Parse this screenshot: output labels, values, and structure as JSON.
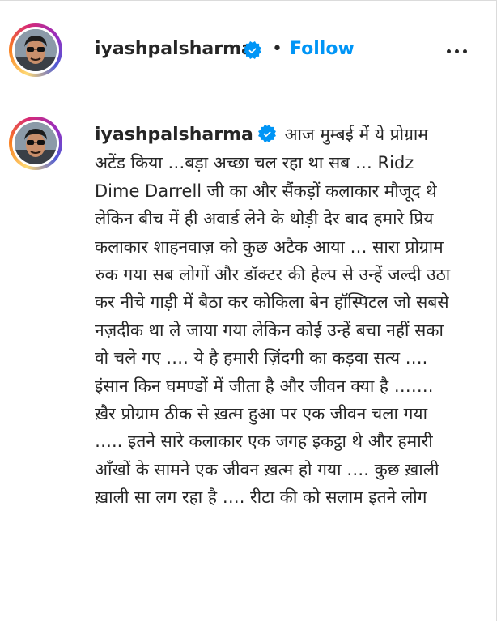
{
  "post": {
    "username": "iyashpalsharma",
    "separator": "•",
    "follow_label": "Follow",
    "icons": {
      "verified": "verified-badge-icon",
      "more": "more-options-icon"
    },
    "colors": {
      "accent": "#0095f6",
      "text": "#262626",
      "verified": "#0095f6"
    }
  },
  "caption": {
    "username": "iyashpalsharma",
    "text": "आज मुम्बई में ये प्रोग्राम अटेंड किया …बड़ा अच्छा चल रहा था सब … Ridz Dime Darrell जी का और सैंकड़ों कलाकार मौजूद थे लेकिन बीच में ही अवार्ड लेने के थोड़ी देर बाद हमारे प्रिय कलाकार शाहनवाज़ को कुछ अटैक आया … सारा प्रोग्राम रुक गया सब लोगों और डॉक्टर की हेल्प से उन्हें जल्दी उठा कर नीचे गाड़ी में बैठा कर कोकिला बेन हॉस्पिटल जो सबसे नज़दीक था ले जाया गया लेकिन कोई उन्हें बचा नहीं सका वो चले गए …. ये है हमारी ज़िंदगी का कड़वा सत्य …. इंसान किन घमण्डों में जीता है और जीवन क्या है ……. ख़ैर प्रोग्राम ठीक से ख़त्म हुआ पर एक जीवन चला गया ….. इतने सारे कलाकार एक जगह इकट्ठा थे और हमारी आँखों के सामने एक जीवन ख़त्म हो गया …. कुछ ख़ाली ख़ाली सा लग रहा है …. रीटा की को सलाम इतने लोग"
  }
}
